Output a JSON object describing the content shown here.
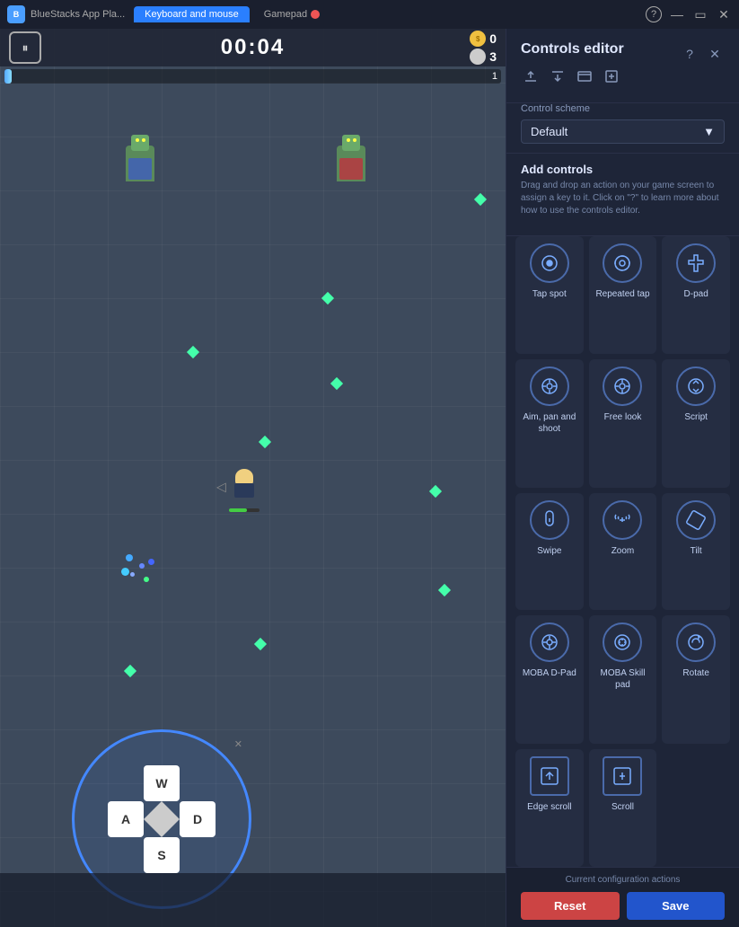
{
  "titleBar": {
    "appName": "BlueStacks App Pla...",
    "tabs": [
      {
        "id": "keyboard",
        "label": "Keyboard and mouse",
        "active": true
      },
      {
        "id": "gamepad",
        "label": "Gamepad",
        "active": false
      }
    ],
    "windowControls": [
      "minimize",
      "restore",
      "close"
    ]
  },
  "gameArea": {
    "timer": "00:04",
    "score1": "0",
    "score2": "3",
    "healthBarNum": "1",
    "dpad": {
      "keys": {
        "up": "W",
        "left": "A",
        "right": "D",
        "down": "S"
      }
    }
  },
  "controlsPanel": {
    "title": "Controls editor",
    "controlScheme": {
      "label": "Control scheme",
      "selectedOption": "Default"
    },
    "addControls": {
      "title": "Add controls",
      "description": "Drag and drop an action on your game screen to assign a key to it. Click on \"?\" to learn more about how to use the controls editor."
    },
    "controls": [
      {
        "id": "tap-spot",
        "label": "Tap spot",
        "iconType": "circle-dot"
      },
      {
        "id": "repeated-tap",
        "label": "Repeated tap",
        "iconType": "repeated-tap"
      },
      {
        "id": "d-pad",
        "label": "D-pad",
        "iconType": "dpad"
      },
      {
        "id": "aim-pan-shoot",
        "label": "Aim, pan and shoot",
        "iconType": "aim"
      },
      {
        "id": "free-look",
        "label": "Free look",
        "iconType": "free-look"
      },
      {
        "id": "script",
        "label": "Script",
        "iconType": "script"
      },
      {
        "id": "swipe",
        "label": "Swipe",
        "iconType": "swipe"
      },
      {
        "id": "zoom",
        "label": "Zoom",
        "iconType": "zoom"
      },
      {
        "id": "tilt",
        "label": "Tilt",
        "iconType": "tilt"
      },
      {
        "id": "moba-dpad",
        "label": "MOBA D-Pad",
        "iconType": "moba-dpad"
      },
      {
        "id": "moba-skill",
        "label": "MOBA Skill pad",
        "iconType": "moba-skill"
      },
      {
        "id": "rotate",
        "label": "Rotate",
        "iconType": "rotate"
      },
      {
        "id": "edge-scroll",
        "label": "Edge scroll",
        "iconType": "edge-scroll"
      },
      {
        "id": "scroll",
        "label": "Scroll",
        "iconType": "scroll"
      }
    ],
    "bottomBar": {
      "configLabel": "Current configuration actions",
      "resetLabel": "Reset",
      "saveLabel": "Save"
    }
  }
}
